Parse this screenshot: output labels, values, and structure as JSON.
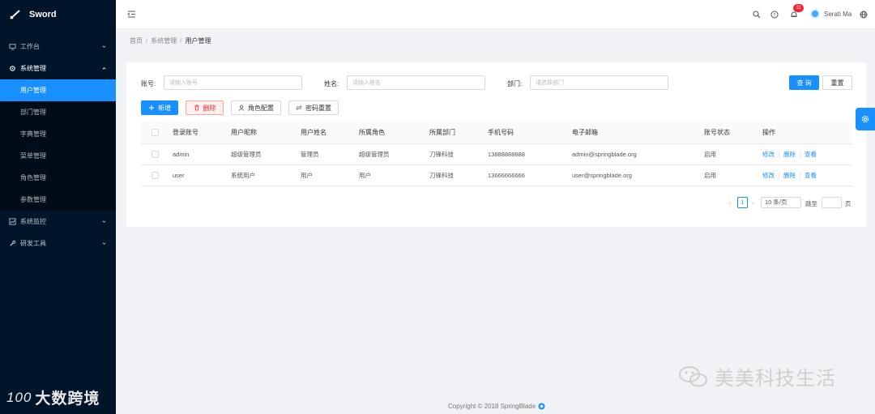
{
  "app": {
    "name": "Sword"
  },
  "sidebar": {
    "items": [
      {
        "label": "工作台"
      },
      {
        "label": "系统管理"
      },
      {
        "label": "系统监控"
      },
      {
        "label": "研发工具"
      }
    ],
    "system_submenu": [
      {
        "label": "用户管理"
      },
      {
        "label": "部门管理"
      },
      {
        "label": "字典管理"
      },
      {
        "label": "菜单管理"
      },
      {
        "label": "角色管理"
      },
      {
        "label": "参数管理"
      }
    ]
  },
  "header": {
    "notification_count": "11",
    "username": "Serati Ma"
  },
  "breadcrumb": [
    "首页",
    "系统管理",
    "用户管理"
  ],
  "search": {
    "account_label": "账号:",
    "account_placeholder": "请输入账号",
    "name_label": "姓名:",
    "name_placeholder": "请输入姓名",
    "dept_label": "部门:",
    "dept_placeholder": "请选择部门",
    "query_label": "查 询",
    "reset_label": "重置"
  },
  "toolbar": {
    "add_label": "新增",
    "delete_label": "删除",
    "role_label": "角色配置",
    "pwd_label": "密码重置"
  },
  "table": {
    "columns": [
      "登录账号",
      "用户昵称",
      "用户姓名",
      "所属角色",
      "所属部门",
      "手机号码",
      "电子邮箱",
      "账号状态",
      "操作"
    ],
    "rows": [
      {
        "account": "admin",
        "nickname": "超级管理员",
        "name": "管理员",
        "role": "超级管理员",
        "dept": "刀锋科技",
        "phone": "13888888888",
        "email": "admin@springblade.org",
        "status": "启用"
      },
      {
        "account": "user",
        "nickname": "系统用户",
        "name": "用户",
        "role": "用户",
        "dept": "刀锋科技",
        "phone": "13666666666",
        "email": "user@springblade.org",
        "status": "启用"
      }
    ],
    "ops": {
      "edit": "修改",
      "delete": "删除",
      "view": "查看"
    }
  },
  "pagination": {
    "current": "1",
    "page_size": "10 条/页",
    "jump_label": "跳至",
    "page_label": "页"
  },
  "footer": {
    "text": "Copyright © 2018 SpringBlade"
  },
  "watermarks": {
    "left_num": "100",
    "left_text": "大数跨境",
    "right_text": "美美科技生活"
  },
  "colors": {
    "primary": "#1890ff",
    "sidebar_bg": "#001529",
    "danger": "#f5222d"
  }
}
